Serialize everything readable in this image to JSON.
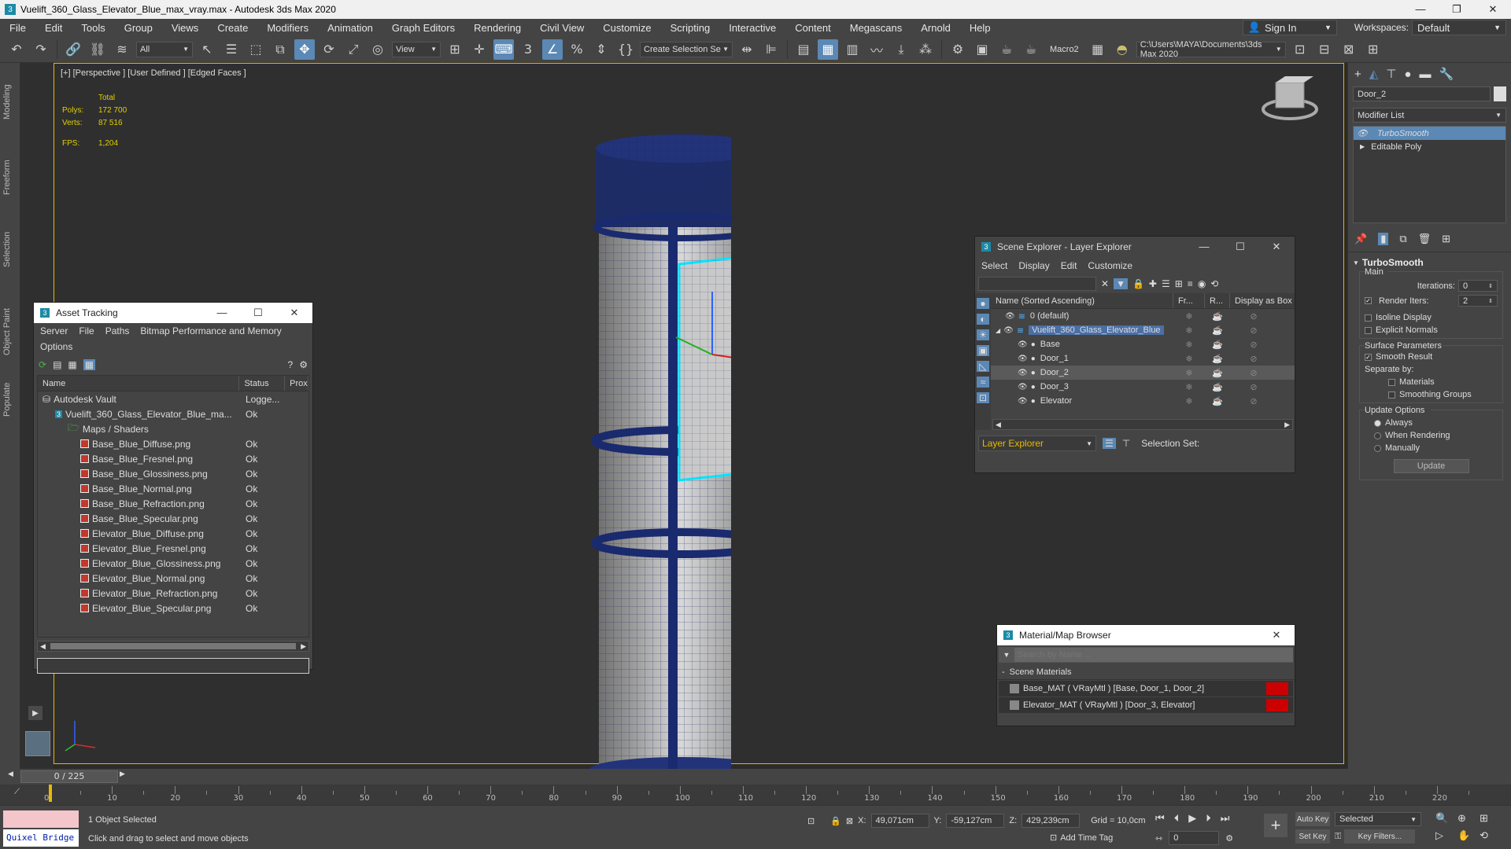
{
  "window": {
    "title": "Vuelift_360_Glass_Elevator_Blue_max_vray.max - Autodesk 3ds Max 2020",
    "app_icon": "3",
    "minimize": "—",
    "maximize": "❐",
    "close": "✕"
  },
  "menubar": {
    "items": [
      "File",
      "Edit",
      "Tools",
      "Group",
      "Views",
      "Create",
      "Modifiers",
      "Animation",
      "Graph Editors",
      "Rendering",
      "Civil View",
      "Customize",
      "Scripting",
      "Interactive",
      "Content",
      "Megascans",
      "Arnold",
      "Help"
    ],
    "sign_in": "Sign In",
    "workspaces_label": "Workspaces:",
    "workspace_value": "Default"
  },
  "toolbar": {
    "selection_filter": "All",
    "ref_coord": "View",
    "create_selection_set": "Create Selection Se",
    "macro": "Macro2",
    "project_path": "C:\\Users\\MAYA\\Documents\\3ds Max 2020"
  },
  "left_tabs": [
    "Modeling",
    "Freeform",
    "Selection",
    "Object Paint",
    "Populate"
  ],
  "viewport": {
    "label": "[+] [Perspective ] [User Defined ] [Edged Faces ]",
    "stats": {
      "total_label": "Total",
      "polys_label": "Polys:",
      "polys_value": "172 700",
      "verts_label": "Verts:",
      "verts_value": "87 516",
      "fps_label": "FPS:",
      "fps_value": "1,204"
    }
  },
  "asset_tracking": {
    "title": "Asset Tracking",
    "menu": [
      "Server",
      "File",
      "Paths",
      "Bitmap Performance and Memory"
    ],
    "menu2": [
      "Options"
    ],
    "columns": [
      "Name",
      "Status",
      "Prox"
    ],
    "rows": [
      {
        "name": "Autodesk Vault",
        "status": "Logge...",
        "indent": 0,
        "icon": "vault"
      },
      {
        "name": "Vuelift_360_Glass_Elevator_Blue_ma...",
        "status": "Ok",
        "indent": 1,
        "icon": "max"
      },
      {
        "name": "Maps / Shaders",
        "status": "",
        "indent": 2,
        "icon": "folder"
      },
      {
        "name": "Base_Blue_Diffuse.png",
        "status": "Ok",
        "indent": 3,
        "icon": "file"
      },
      {
        "name": "Base_Blue_Fresnel.png",
        "status": "Ok",
        "indent": 3,
        "icon": "file"
      },
      {
        "name": "Base_Blue_Glossiness.png",
        "status": "Ok",
        "indent": 3,
        "icon": "file"
      },
      {
        "name": "Base_Blue_Normal.png",
        "status": "Ok",
        "indent": 3,
        "icon": "file"
      },
      {
        "name": "Base_Blue_Refraction.png",
        "status": "Ok",
        "indent": 3,
        "icon": "file"
      },
      {
        "name": "Base_Blue_Specular.png",
        "status": "Ok",
        "indent": 3,
        "icon": "file"
      },
      {
        "name": "Elevator_Blue_Diffuse.png",
        "status": "Ok",
        "indent": 3,
        "icon": "file"
      },
      {
        "name": "Elevator_Blue_Fresnel.png",
        "status": "Ok",
        "indent": 3,
        "icon": "file"
      },
      {
        "name": "Elevator_Blue_Glossiness.png",
        "status": "Ok",
        "indent": 3,
        "icon": "file"
      },
      {
        "name": "Elevator_Blue_Normal.png",
        "status": "Ok",
        "indent": 3,
        "icon": "file"
      },
      {
        "name": "Elevator_Blue_Refraction.png",
        "status": "Ok",
        "indent": 3,
        "icon": "file"
      },
      {
        "name": "Elevator_Blue_Specular.png",
        "status": "Ok",
        "indent": 3,
        "icon": "file"
      }
    ]
  },
  "scene_explorer": {
    "title": "Scene Explorer - Layer Explorer",
    "menu": [
      "Select",
      "Display",
      "Edit",
      "Customize"
    ],
    "columns": [
      "Name (Sorted Ascending)",
      "Fr...",
      "R...",
      "Display as Box"
    ],
    "rows": [
      {
        "name": "0 (default)",
        "indent": 0,
        "selected": false
      },
      {
        "name": "Vuelift_360_Glass_Elevator_Blue",
        "indent": 0,
        "selected": false,
        "highlight": true
      },
      {
        "name": "Base",
        "indent": 1,
        "selected": false
      },
      {
        "name": "Door_1",
        "indent": 1,
        "selected": false
      },
      {
        "name": "Door_2",
        "indent": 1,
        "selected": true
      },
      {
        "name": "Door_3",
        "indent": 1,
        "selected": false
      },
      {
        "name": "Elevator",
        "indent": 1,
        "selected": false
      }
    ],
    "footer_dropdown": "Layer Explorer",
    "selection_set_label": "Selection Set:"
  },
  "material_browser": {
    "title": "Material/Map Browser",
    "search_placeholder": "Search by Name ...",
    "section": "Scene Materials",
    "items": [
      "Base_MAT  ( VRayMtl )  [Base, Door_1, Door_2]",
      "Elevator_MAT  ( VRayMtl )  [Door_3, Elevator]"
    ]
  },
  "command_panel": {
    "object_name": "Door_2",
    "modifier_list": "Modifier List",
    "stack": [
      "TurboSmooth",
      "Editable Poly"
    ],
    "turbosmooth": {
      "title": "TurboSmooth",
      "main_label": "Main",
      "iterations_label": "Iterations:",
      "iterations_value": "0",
      "render_iters_label": "Render Iters:",
      "render_iters_value": "2",
      "isoline_label": "Isoline Display",
      "explicit_normals_label": "Explicit Normals",
      "surface_params_label": "Surface Parameters",
      "smooth_result_label": "Smooth Result",
      "separate_by_label": "Separate by:",
      "materials_label": "Materials",
      "smoothing_groups_label": "Smoothing Groups",
      "update_options_label": "Update Options",
      "always_label": "Always",
      "when_rendering_label": "When Rendering",
      "manually_label": "Manually",
      "update_button": "Update"
    }
  },
  "timeline": {
    "frame_display": "0 / 225",
    "ticks": [
      "0",
      "10",
      "20",
      "30",
      "40",
      "50",
      "60",
      "70",
      "80",
      "90",
      "100",
      "110",
      "120",
      "130",
      "140",
      "150",
      "160",
      "170",
      "180",
      "190",
      "200",
      "210",
      "220"
    ]
  },
  "statusbar": {
    "quixel": "Quixel Bridge",
    "selected_text": "1 Object Selected",
    "prompt_text": "Click and drag to select and move objects",
    "x_label": "X:",
    "x_value": "49,071cm",
    "y_label": "Y:",
    "y_value": "-59,127cm",
    "z_label": "Z:",
    "z_value": "429,239cm",
    "grid_text": "Grid = 10,0cm",
    "add_time_tag": "Add Time Tag",
    "auto_key": "Auto Key",
    "set_key": "Set Key",
    "key_mode_value": "Selected",
    "key_filters": "Key Filters...",
    "current_frame": "0"
  },
  "colors": {
    "accent": "#5b88b5",
    "viewport_border": "#e8b900",
    "mesh_wire": "#1a2a6e",
    "selection": "#00e5ff"
  }
}
